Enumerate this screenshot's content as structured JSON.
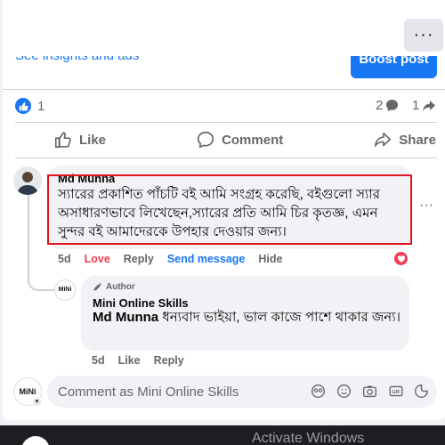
{
  "post": {
    "insights_link": "See insights and ads",
    "boost_label": "Boost post",
    "more_label": "···"
  },
  "stats": {
    "like_count": "1",
    "comment_count": "2",
    "share_count": "1"
  },
  "actions": {
    "like": "Like",
    "comment": "Comment",
    "share": "Share"
  },
  "comment": {
    "author": "Md Munna",
    "text": "স্যারের প্রকাশিত পাঁচটি বই আমি সংগ্রহ করেছি, বইগুলো স্যার অসাধারণভাবে লিখেছেন,স্যারের প্রতি আমি চির কৃতজ্ঞ, এমন সুন্দর বই আমাদেরকে উপহার দেওয়ার জন্য।",
    "time": "5d",
    "love_label": "Love",
    "reply_label": "Reply",
    "send_message_label": "Send message",
    "hide_label": "Hide",
    "options_label": "···"
  },
  "reply": {
    "badge": "Author",
    "author": "Mini Online Skills",
    "mention": "Md Munna",
    "text": " ধন্যবাদ ভাইয়া, ভাল কাজে পাশে থাকার জন্য।",
    "time": "5d",
    "like_label": "Like",
    "reply_label": "Reply"
  },
  "composer": {
    "placeholder": "Comment as Mini Online Skills",
    "avatar_text": "MiNi"
  },
  "overlay": {
    "activate": "Activate Windows"
  },
  "colors": {
    "accent": "#1877f2",
    "love": "#f33e58",
    "highlight_border": "#e0141c"
  }
}
